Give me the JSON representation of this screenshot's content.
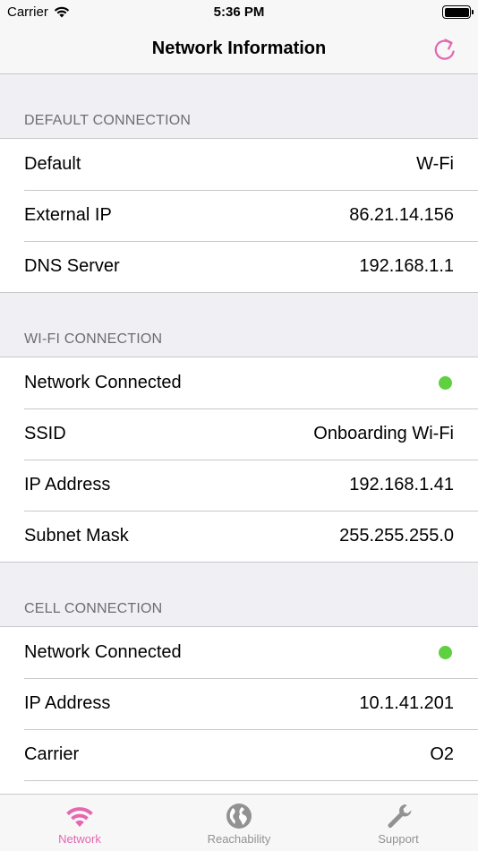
{
  "status_bar": {
    "carrier": "Carrier",
    "time": "5:36 PM"
  },
  "nav": {
    "title": "Network Information",
    "refresh_icon": "refresh-icon",
    "accent": "#e467b0"
  },
  "sections": {
    "default": {
      "header": "DEFAULT CONNECTION",
      "rows": [
        {
          "label": "Default",
          "value": "W-Fi"
        },
        {
          "label": "External IP",
          "value": "86.21.14.156"
        },
        {
          "label": "DNS Server",
          "value": "192.168.1.1"
        }
      ]
    },
    "wifi": {
      "header": "WI-FI CONNECTION",
      "rows": [
        {
          "label": "Network Connected",
          "value_color": "#5fd03f"
        },
        {
          "label": "SSID",
          "value": "Onboarding Wi-Fi"
        },
        {
          "label": "IP Address",
          "value": "192.168.1.41"
        },
        {
          "label": "Subnet Mask",
          "value": "255.255.255.0"
        }
      ]
    },
    "cell": {
      "header": "CELL CONNECTION",
      "rows": [
        {
          "label": "Network Connected",
          "value_color": "#5fd03f"
        },
        {
          "label": "IP Address",
          "value": "10.1.41.201"
        },
        {
          "label": "Carrier",
          "value": "O2"
        }
      ]
    }
  },
  "tabs": [
    {
      "label": "Network",
      "icon": "wifi-icon",
      "active": true
    },
    {
      "label": "Reachability",
      "icon": "globe-icon",
      "active": false
    },
    {
      "label": "Support",
      "icon": "wrench-icon",
      "active": false
    }
  ]
}
